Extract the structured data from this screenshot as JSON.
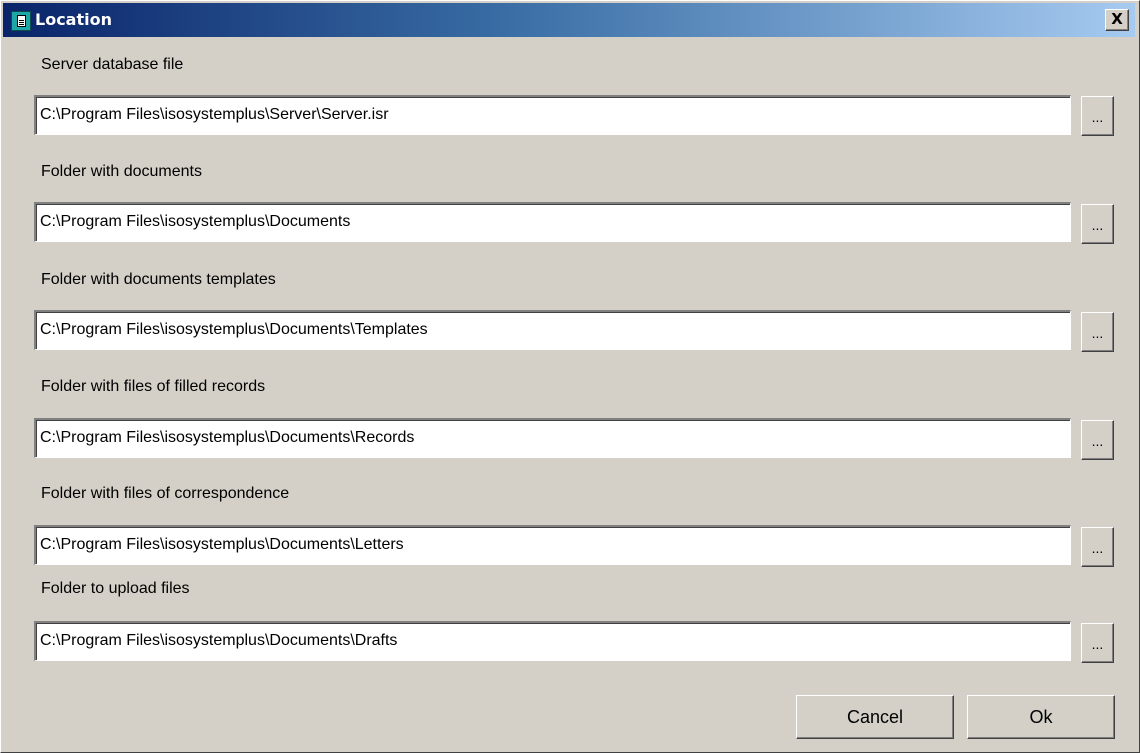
{
  "window": {
    "title": "Location",
    "close_label": "X"
  },
  "fields": [
    {
      "label": "Server database  file",
      "value": "C:\\Program Files\\isosystemplus\\Server\\Server.isr",
      "browse_label": "..."
    },
    {
      "label": "Folder with documents",
      "value": "C:\\Program Files\\isosystemplus\\Documents",
      "browse_label": "..."
    },
    {
      "label": "Folder with documents templates",
      "value": "C:\\Program Files\\isosystemplus\\Documents\\Templates",
      "browse_label": "..."
    },
    {
      "label": "Folder with files of filled records",
      "value": "C:\\Program Files\\isosystemplus\\Documents\\Records",
      "browse_label": "..."
    },
    {
      "label": "Folder with files of correspondence",
      "value": "C:\\Program Files\\isosystemplus\\Documents\\Letters",
      "browse_label": "..."
    },
    {
      "label": "Folder to upload files",
      "value": "C:\\Program Files\\isosystemplus\\Documents\\Drafts",
      "browse_label": "..."
    }
  ],
  "buttons": {
    "cancel_label": "Cancel",
    "ok_label": "Ok"
  },
  "colors": {
    "dialog_face": "#d4d0c8",
    "titlebar_start": "#0a246a",
    "titlebar_end": "#a6caf0",
    "title_text": "#ffffff"
  }
}
